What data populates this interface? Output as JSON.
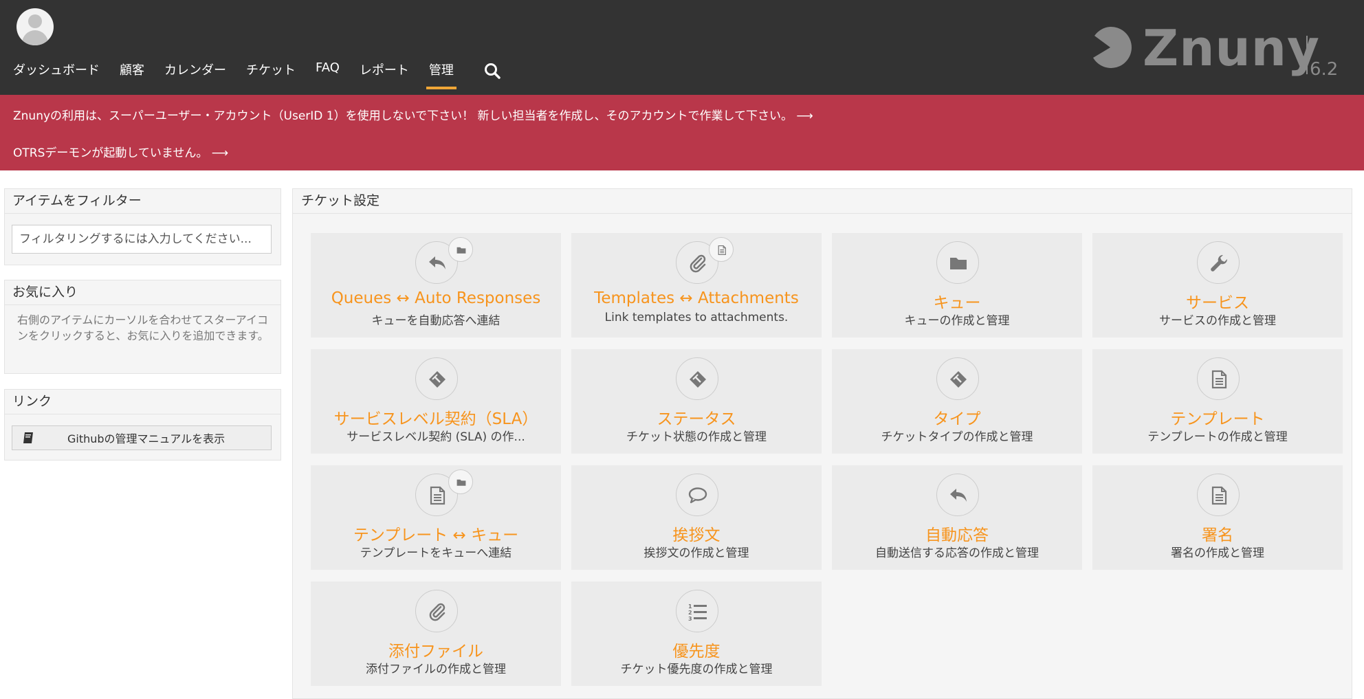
{
  "header": {
    "nav": [
      "ダッシュボード",
      "顧客",
      "カレンダー",
      "チケット",
      "FAQ",
      "レポート",
      "管理"
    ],
    "active_nav": "管理",
    "logo_text": "Znuny",
    "logo_version": "6.2",
    "icons": [
      "avatar-icon",
      "search-icon"
    ]
  },
  "alerts": [
    "Znunyの利用は、スーパーユーザー・アカウント（UserID 1）を使用しないで下さい！ 新しい担当者を作成し、そのアカウントで作業して下さい。 ⟶",
    "OTRSデーモンが起動していません。 ⟶"
  ],
  "sidebar": {
    "filter": {
      "title": "アイテムをフィルター",
      "placeholder": "フィルタリングするには入力してください..."
    },
    "favorites": {
      "title": "お気に入り",
      "text": "右側のアイテムにカーソルを合わせてスターアイコンをクリックすると、お気に入りを追加できます。"
    },
    "links": {
      "title": "リンク",
      "github_label": "Githubの管理マニュアルを表示",
      "icon": "book-icon"
    }
  },
  "main": {
    "title": "チケット設定",
    "tiles": [
      {
        "title": "Queues ↔ Auto Responses",
        "desc": "キューを自動応答へ連結",
        "icon": "reply-icon",
        "badge": "folder-icon"
      },
      {
        "title": "Templates ↔ Attachments",
        "desc": "Link templates to attachments.",
        "icon": "paperclip-icon",
        "badge": "document-icon"
      },
      {
        "title": "キュー",
        "desc": "キューの作成と管理",
        "icon": "folder-icon",
        "badge": ""
      },
      {
        "title": "サービス",
        "desc": "サービスの作成と管理",
        "icon": "wrench-icon",
        "badge": ""
      },
      {
        "title": "サービスレベル契約（SLA）",
        "desc": "サービスレベル契約 (SLA) の作...",
        "icon": "ticket-icon",
        "badge": ""
      },
      {
        "title": "ステータス",
        "desc": "チケット状態の作成と管理",
        "icon": "ticket-icon",
        "badge": ""
      },
      {
        "title": "タイプ",
        "desc": "チケットタイプの作成と管理",
        "icon": "ticket-icon",
        "badge": ""
      },
      {
        "title": "テンプレート",
        "desc": "テンプレートの作成と管理",
        "icon": "document-icon",
        "badge": ""
      },
      {
        "title": "テンプレート ↔ キュー",
        "desc": "テンプレートをキューへ連結",
        "icon": "document-icon",
        "badge": "folder-icon"
      },
      {
        "title": "挨拶文",
        "desc": "挨拶文の作成と管理",
        "icon": "speech-bubble-icon",
        "badge": ""
      },
      {
        "title": "自動応答",
        "desc": "自動送信する応答の作成と管理",
        "icon": "reply-icon",
        "badge": ""
      },
      {
        "title": "署名",
        "desc": "署名の作成と管理",
        "icon": "document-icon",
        "badge": ""
      },
      {
        "title": "添付ファイル",
        "desc": "添付ファイルの作成と管理",
        "icon": "paperclip-icon",
        "badge": ""
      },
      {
        "title": "優先度",
        "desc": "チケット優先度の作成と管理",
        "icon": "ordered-list-icon",
        "badge": ""
      }
    ]
  }
}
